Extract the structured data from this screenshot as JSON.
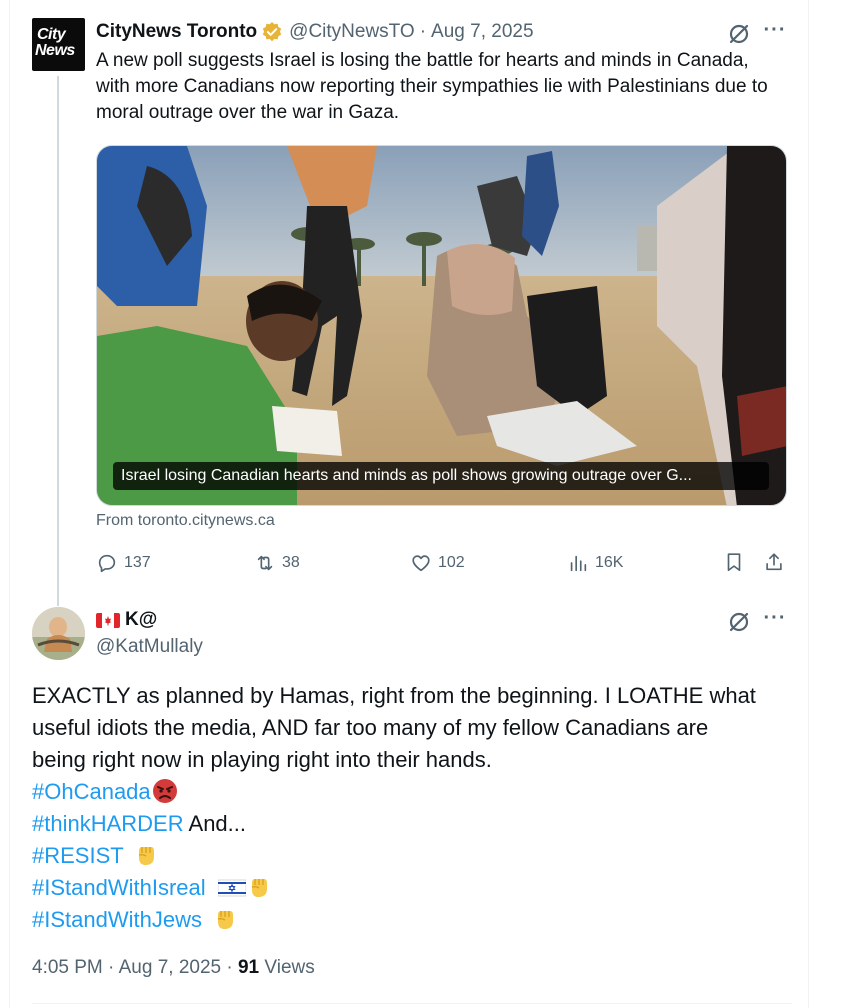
{
  "quoted_tweet": {
    "avatar_text_line1": "City",
    "avatar_text_line2": "News",
    "author_name": "CityNews Toronto",
    "handle": "@CityNewsTO",
    "separator": "·",
    "date": "Aug 7, 2025",
    "text": "A new poll suggests Israel is losing the battle for hearts and minds in Canada, with more Canadians now reporting their sympathies lie with Palestinians due to moral outrage over the war in Gaza.",
    "card_caption": "Israel losing Canadian hearts and minds as poll shows growing outrage over G...",
    "card_source": "From toronto.citynews.ca",
    "stats": {
      "replies": "137",
      "reposts": "38",
      "likes": "102",
      "views": "16K"
    },
    "icons": [
      "verified-badge-icon",
      "grok-icon",
      "more-icon",
      "reply-icon",
      "repost-icon",
      "like-icon",
      "views-icon",
      "bookmark-icon",
      "share-icon"
    ]
  },
  "main_tweet": {
    "author_name": "K@",
    "handle": "@KatMullaly",
    "lines": {
      "l1": "EXACTLY as planned by Hamas, right from the beginning. I LOATHE what",
      "l2": "useful idiots the media, AND far too many of my fellow Canadians are",
      "l3": "being right now in playing right into their hands."
    },
    "hashtags": {
      "h1": "#OhCanada",
      "h2": "#thinkHARDER",
      "h2_suffix": "And...",
      "h3": "#RESIST",
      "h4": "#IStandWithIsreal",
      "h5": "#IStandWithJews"
    },
    "time": "4:05 PM",
    "separator": "·",
    "date": "Aug 7, 2025",
    "views_count": "91",
    "views_label": "Views",
    "icons": [
      "canada-flag-icon",
      "angry-face-icon",
      "raised-fist-icon",
      "israel-flag-icon"
    ]
  },
  "colors": {
    "link": "#1d9bf0",
    "muted": "#536471",
    "text": "#0f1419",
    "verified_gold": "#e8b339"
  }
}
